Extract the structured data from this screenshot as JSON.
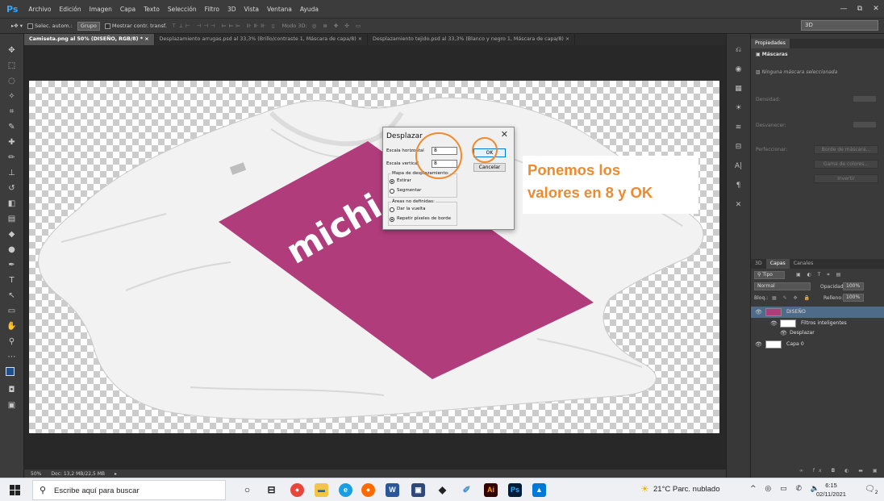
{
  "app": {
    "logo": "Ps",
    "menu": [
      "Archivo",
      "Edición",
      "Imagen",
      "Capa",
      "Texto",
      "Selección",
      "Filtro",
      "3D",
      "Vista",
      "Ventana",
      "Ayuda"
    ],
    "window_controls": [
      "—",
      "⧉",
      "✕"
    ]
  },
  "options_bar": {
    "auto_select_label": "Selec. autom.:",
    "auto_select_value": "Grupo",
    "show_transform_label": "Mostrar contr. transf.",
    "mode_3d_label": "Modo 3D:",
    "workspace_value": "3D"
  },
  "tabs": [
    {
      "label": "Camiseta.png al 50% (DISEÑO, RGB/8) *",
      "active": true
    },
    {
      "label": "Desplazamiento arrugas.psd al 33,3% (Brillo/contraste 1, Máscara de capa/8)",
      "active": false
    },
    {
      "label": "Desplazamiento tejido.psd al 33,3% (Blanco y negro 1, Máscara de capa/8)",
      "active": false
    }
  ],
  "canvas": {
    "shirt_text": "michi",
    "print_color": "#b03c7c"
  },
  "status": {
    "zoom": "50%",
    "doc": "Doc: 13,2 MB/22,5 MB"
  },
  "dialog": {
    "title": "Desplazar",
    "close": "✕",
    "h_scale_label": "Escala horizontal",
    "h_scale_value": "8",
    "v_scale_label": "Escala vertical",
    "v_scale_value": "8",
    "ok_label": "OK",
    "cancel_label": "Cancelar",
    "map_group_label": "Mapa de desplazamiento:",
    "map_options": [
      {
        "label": "Estirar",
        "selected": true
      },
      {
        "label": "Segmentar",
        "selected": false
      }
    ],
    "undefined_group_label": "Áreas no definidas:",
    "undefined_options": [
      {
        "label": "Dar la vuelta",
        "selected": false
      },
      {
        "label": "Repetir píxeles de borde",
        "selected": true
      }
    ]
  },
  "annotation": {
    "line1": "Ponemos los",
    "line2": "valores en 8 y OK",
    "color": "#ef8a2e"
  },
  "properties_panel": {
    "tab": "Propiedades",
    "section": "Máscaras",
    "no_mask": "Ninguna máscara seleccionada",
    "density_label": "Densidad:",
    "feather_label": "Desvanecer:",
    "refine_label": "Perfeccionar:",
    "mask_edge_button": "Borde de máscara...",
    "color_range_button": "Gama de colores...",
    "invert_button": "Invertir"
  },
  "layers_panel": {
    "tabs": [
      "3D",
      "Capas",
      "Canales"
    ],
    "active_tab": "Capas",
    "filter_value": "Tipo",
    "blend_mode": "Normal",
    "opacity_label": "Opacidad:",
    "opacity_value": "100%",
    "lock_label": "Bloq.:",
    "fill_label": "Relleno:",
    "fill_value": "100%",
    "layers": [
      {
        "name": "DISEÑO",
        "selected": true
      },
      {
        "name": "Filtros inteligentes",
        "selected": false
      },
      {
        "name": "Desplazar",
        "selected": false
      },
      {
        "name": "Capa 0",
        "selected": false
      }
    ]
  },
  "taskbar": {
    "search_placeholder": "Escribe aquí para buscar",
    "weather": "21°C  Parc. nublado",
    "time": "6:15",
    "date": "02/11/2021",
    "notification_count": "2"
  }
}
